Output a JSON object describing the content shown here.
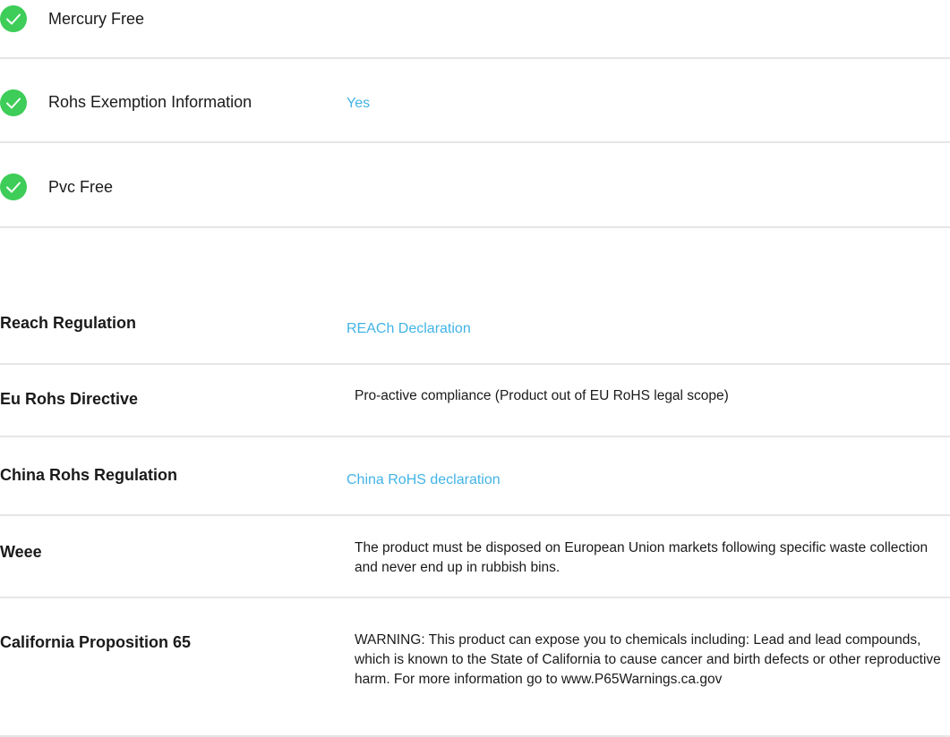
{
  "features": [
    {
      "label": "Mercury Free",
      "value": ""
    },
    {
      "label": "Rohs Exemption Information",
      "value": "Yes"
    },
    {
      "label": "Pvc Free",
      "value": ""
    }
  ],
  "regulations": [
    {
      "label": "Reach Regulation",
      "value": "REACh Declaration"
    },
    {
      "label": "Eu Rohs Directive",
      "value": "Pro-active compliance (Product out of EU RoHS legal scope)"
    },
    {
      "label": "China Rohs Regulation",
      "value": "China RoHS declaration"
    },
    {
      "label": "Weee",
      "value": "The product must be disposed on European Union markets following specific waste collection and never end up in rubbish bins."
    },
    {
      "label": "California Proposition 65",
      "value": "WARNING: This product can expose you to chemicals including: Lead and lead compounds, which is known to the State of California to cause cancer and birth defects or other reproductive harm. For more information go to www.P65Warnings.ca.gov"
    }
  ],
  "colors": {
    "check": "#3dcd58",
    "link": "#42b4e6",
    "divider": "#e6e6e6"
  },
  "icons": {
    "feature_status": "check-circle-icon"
  }
}
